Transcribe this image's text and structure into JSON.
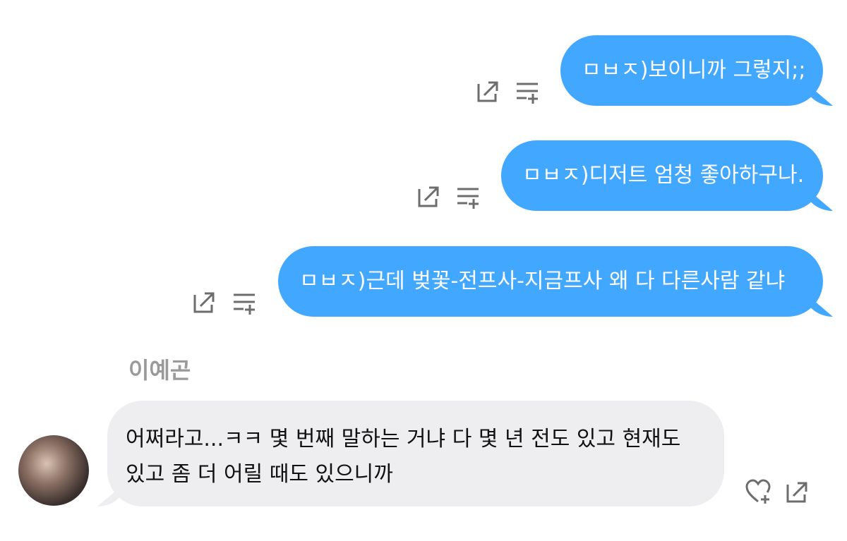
{
  "messages_out": [
    {
      "text": "ㅁㅂㅈ)보이니까 그렇지;;"
    },
    {
      "text": "ㅁㅂㅈ)디저트 엄청 좋아하구나."
    },
    {
      "text": "ㅁㅂㅈ)근데 벚꽃-전프사-지금프사 왜 다 다른사람 같냐"
    }
  ],
  "incoming": {
    "sender": "이예곤",
    "lines": [
      "어쩌라고...ㅋㅋ 몇 번째 말하는 거냐 다 몇 년 전도 있고 현재도",
      "있고 좀 더 어릴 때도 있으니까"
    ]
  },
  "icons": {
    "share": "share-icon",
    "add_to_list": "add-to-list-icon",
    "heart_add": "heart-add-icon"
  },
  "colors": {
    "outgoing_bubble": "#42a8ff",
    "incoming_bubble": "#eeeef0",
    "icon": "#6d6d6d",
    "sender_name": "#9a9a9a"
  }
}
